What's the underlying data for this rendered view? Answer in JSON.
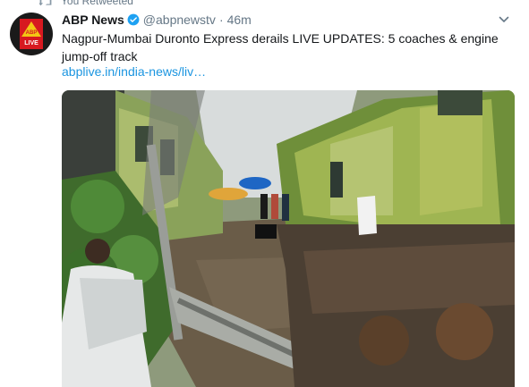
{
  "retweet_context": {
    "label": "You Retweeted",
    "icon": "retweet-icon"
  },
  "tweet": {
    "author_name": "ABP News",
    "handle": "@abpnewstv",
    "separator": "·",
    "time": "46m",
    "text": "Nagpur-Mumbai Duronto Express derails LIVE UPDATES: 5 coaches & engine jump-off track",
    "link": "abplive.in/india-news/liv…",
    "avatar_icon": "abp-live-logo",
    "avatar_logo_text": [
      "ABP",
      "LIVE"
    ]
  },
  "colors": {
    "link": "#1b95e0",
    "verified": "#1da1f2",
    "muted": "#657786",
    "avatar_red": "#d71920",
    "avatar_yellow": "#f3c614"
  }
}
